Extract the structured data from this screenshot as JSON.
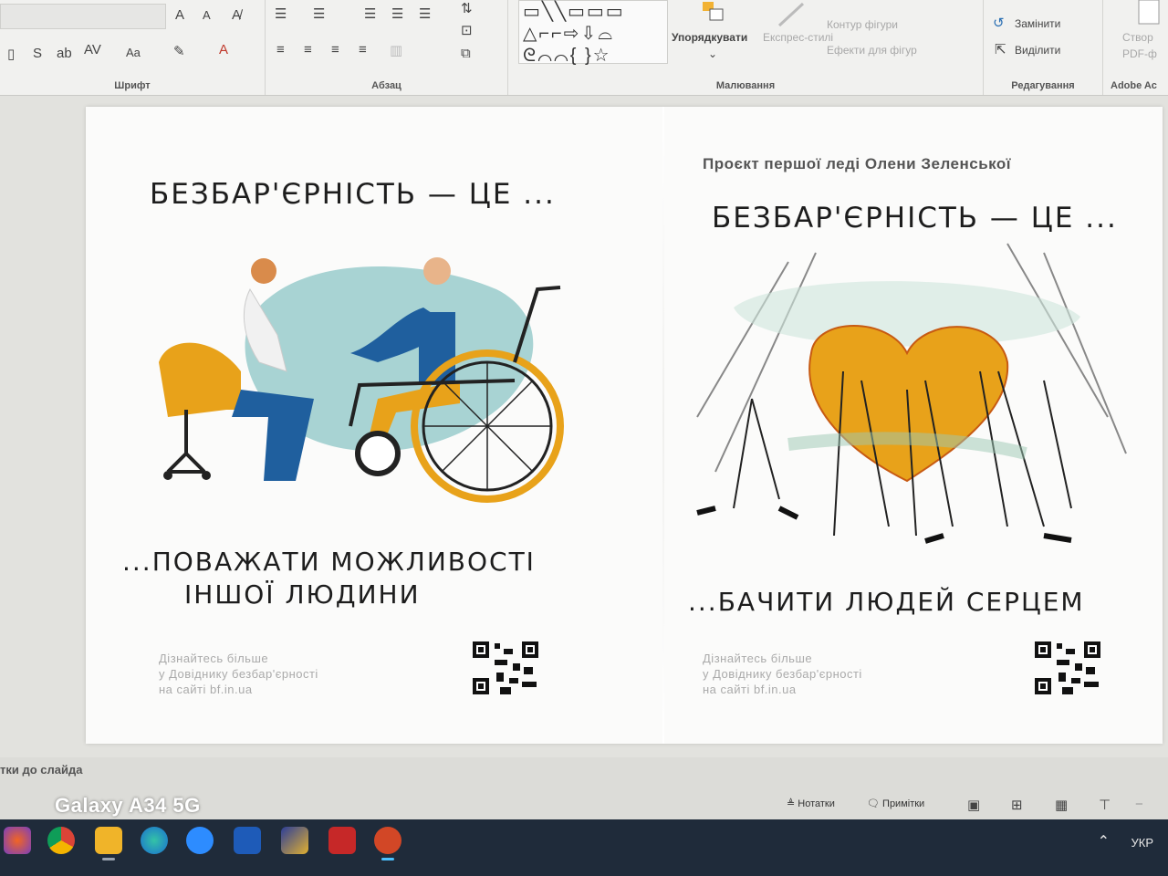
{
  "ribbon": {
    "groups": {
      "font": "Шрифт",
      "paragraph": "Абзац",
      "drawing": "Малювання",
      "editing": "Редагування",
      "adobe": "Adobe Ac"
    },
    "font_controls": [
      "A",
      "A",
      "Aa"
    ],
    "arrange_label": "Упорядкувати",
    "express_styles_label": "Експрес-стилі",
    "shape_outline_label": "Контур фігури",
    "shape_effects_label": "Ефекти для фігур",
    "replace_label": "Замінити",
    "select_label": "Виділити",
    "create_pdf_label": "Створ PDF-ф"
  },
  "slide": {
    "left": {
      "title": "БЕЗБАР'ЄРНІСТЬ — ЦЕ ...",
      "caption_line1": "...ПОВАЖАТИ МОЖЛИВОСТІ",
      "caption_line2": "ІНШОЇ ЛЮДИНИ",
      "info_line1": "Дізнайтесь більше",
      "info_line2": "у Довіднику безбар'єрності",
      "info_line3": "на сайті bf.in.ua"
    },
    "right": {
      "project_label": "Проєкт першої леді Олени Зеленської",
      "title": "БЕЗБАР'ЄРНІСТЬ — ЦЕ ...",
      "caption": "...БАЧИТИ ЛЮДЕЙ СЕРЦЕМ",
      "info_line1": "Дізнайтесь більше",
      "info_line2": "у Довіднику безбар'єрності",
      "info_line3": "на сайті bf.in.ua"
    }
  },
  "status": {
    "notes_hint": "тки до слайда",
    "camera_watermark": "Galaxy A34 5G",
    "notes_button": "Нотатки",
    "comments_button": "Примітки"
  },
  "taskbar": {
    "language": "УКР"
  },
  "colors": {
    "accent_orange": "#e8a21a",
    "accent_blue": "#1f5f9e",
    "teal": "#a8d3d3",
    "taskbar": "#1f2b3a"
  }
}
